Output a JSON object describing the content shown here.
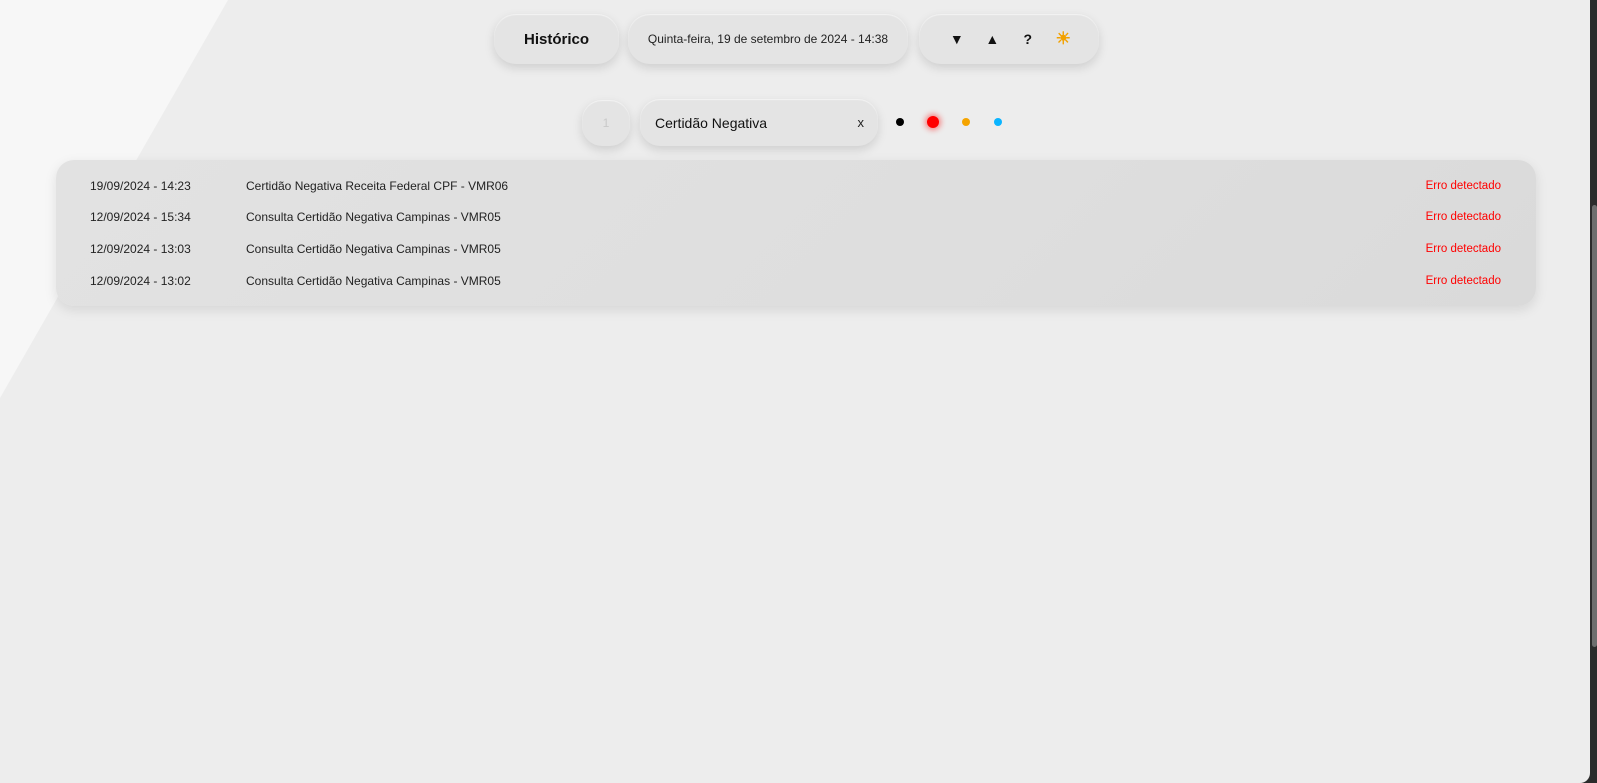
{
  "header": {
    "title": "Histórico",
    "datetime": "Quinta-feira, 19 de setembro de 2024 - 14:38",
    "controls": [
      {
        "icon": "triangle-down-icon",
        "glyph": "▼"
      },
      {
        "icon": "triangle-up-icon",
        "glyph": "▲"
      },
      {
        "icon": "help-icon",
        "glyph": "?"
      },
      {
        "icon": "sun-icon",
        "glyph": "☀"
      }
    ]
  },
  "filters": {
    "page": "1",
    "search_value": "Certidão Negativa",
    "clear_label": "x",
    "status_dots": [
      {
        "name": "black",
        "color": "#000000"
      },
      {
        "name": "red",
        "color": "#ff0000",
        "selected": true
      },
      {
        "name": "orange",
        "color": "#f5a400"
      },
      {
        "name": "blue",
        "color": "#0ab4ff"
      }
    ]
  },
  "history": {
    "rows": [
      {
        "datetime": "19/09/2024 - 14:23",
        "description": "Certidão Negativa Receita Federal CPF - VMR06",
        "status": "Erro detectado"
      },
      {
        "datetime": "12/09/2024 - 15:34",
        "description": "Consulta Certidão Negativa Campinas - VMR05",
        "status": "Erro detectado"
      },
      {
        "datetime": "12/09/2024 - 13:03",
        "description": "Consulta Certidão Negativa Campinas - VMR05",
        "status": "Erro detectado"
      },
      {
        "datetime": "12/09/2024 - 13:02",
        "description": "Consulta Certidão Negativa Campinas - VMR05",
        "status": "Erro detectado"
      }
    ]
  },
  "colors": {
    "background": "#ededed",
    "error": "#ff0000"
  }
}
